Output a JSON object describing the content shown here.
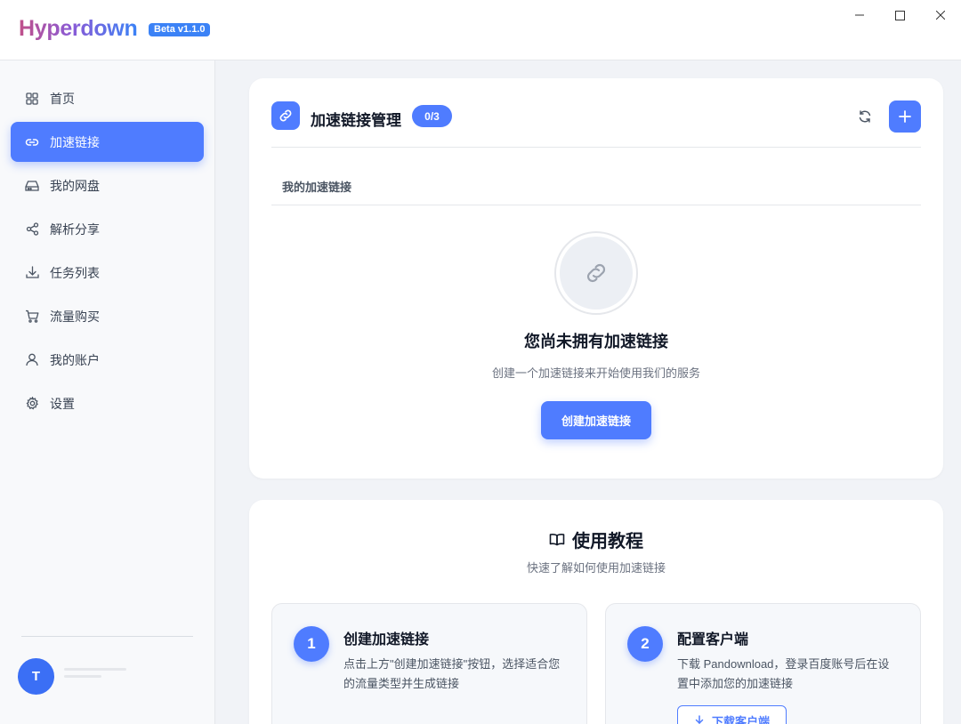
{
  "app": {
    "name": "Hyperdown",
    "version_badge": "Beta v1.1.0"
  },
  "colors": {
    "accent": "#4f7cff",
    "avatar": "#3b6ff5"
  },
  "sidebar": {
    "items": [
      {
        "label": "首页",
        "icon": "grid-icon",
        "active": false
      },
      {
        "label": "加速链接",
        "icon": "link-icon",
        "active": true
      },
      {
        "label": "我的网盘",
        "icon": "drive-icon",
        "active": false
      },
      {
        "label": "解析分享",
        "icon": "share-icon",
        "active": false
      },
      {
        "label": "任务列表",
        "icon": "download-icon",
        "active": false
      },
      {
        "label": "流量购买",
        "icon": "cart-icon",
        "active": false
      },
      {
        "label": "我的账户",
        "icon": "user-icon",
        "active": false
      },
      {
        "label": "设置",
        "icon": "gear-icon",
        "active": false
      }
    ],
    "user": {
      "avatar_letter": "T"
    }
  },
  "links_card": {
    "title": "加速链接管理",
    "count_badge": "0/3",
    "section_label": "我的加速链接",
    "empty_title": "您尚未拥有加速链接",
    "empty_subtitle": "创建一个加速链接来开始使用我们的服务",
    "create_button": "创建加速链接"
  },
  "tutorial": {
    "title": "使用教程",
    "subtitle": "快速了解如何使用加速链接",
    "steps": [
      {
        "num": "1",
        "title": "创建加速链接",
        "desc": "点击上方\"创建加速链接\"按钮，选择适合您的流量类型并生成链接"
      },
      {
        "num": "2",
        "title": "配置客户端",
        "desc": "下载 Pandownload，登录百度账号后在设置中添加您的加速链接",
        "button": "下载客户端"
      }
    ]
  }
}
